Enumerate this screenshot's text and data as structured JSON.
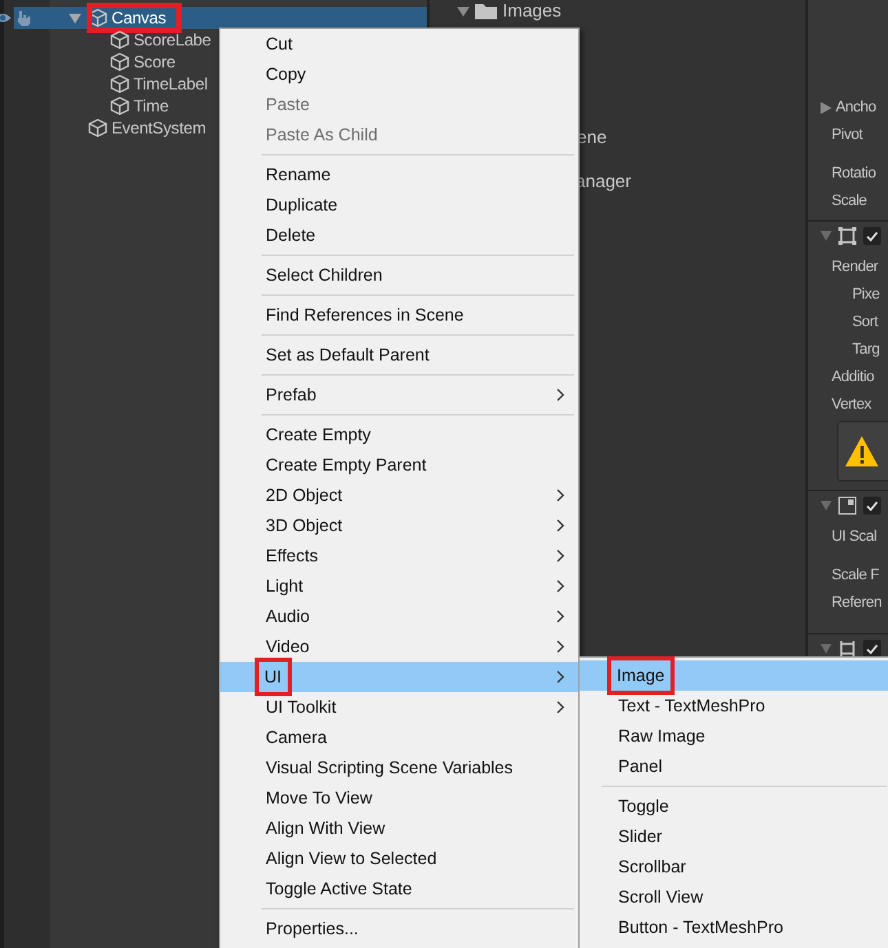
{
  "hierarchy": {
    "rows": [
      {
        "label": "Canvas",
        "selected": true,
        "expanded": true,
        "annotated": true,
        "children": [
          {
            "label": "ScoreLabe"
          },
          {
            "label": "Score"
          },
          {
            "label": "TimeLabel"
          },
          {
            "label": "Time"
          }
        ]
      },
      {
        "label": "EventSystem"
      }
    ]
  },
  "project": {
    "items": [
      {
        "label": "Images",
        "kind": "folder",
        "expanded": true
      },
      {
        "label": "ene",
        "kind": "fragment"
      },
      {
        "label": "anager",
        "kind": "fragment"
      }
    ]
  },
  "inspector": {
    "rows": [
      {
        "kind": "foldout",
        "label": "Ancho"
      },
      {
        "kind": "field",
        "label": "Pivot"
      },
      {
        "kind": "gap"
      },
      {
        "kind": "field",
        "label": "Rotatio"
      },
      {
        "kind": "field",
        "label": "Scale"
      },
      {
        "kind": "header",
        "enabled": true
      },
      {
        "kind": "field",
        "label": "Render"
      },
      {
        "kind": "subfield",
        "label": "Pixe"
      },
      {
        "kind": "subfield",
        "label": "Sort"
      },
      {
        "kind": "subfield",
        "label": "Targ"
      },
      {
        "kind": "field",
        "label": "Additio"
      },
      {
        "kind": "field",
        "label": "Vertex"
      },
      {
        "kind": "warning"
      },
      {
        "kind": "header",
        "enabled": true
      },
      {
        "kind": "field",
        "label": "UI Scal"
      },
      {
        "kind": "gap"
      },
      {
        "kind": "field",
        "label": "Scale F"
      },
      {
        "kind": "field",
        "label": "Referen"
      },
      {
        "kind": "gap"
      },
      {
        "kind": "header",
        "enabled": true
      }
    ]
  },
  "context_menu": {
    "items": [
      {
        "kind": "item",
        "label": "Cut",
        "disabled": false
      },
      {
        "kind": "item",
        "label": "Copy",
        "disabled": false
      },
      {
        "kind": "item",
        "label": "Paste",
        "disabled": true
      },
      {
        "kind": "item",
        "label": "Paste As Child",
        "disabled": true
      },
      {
        "kind": "separator"
      },
      {
        "kind": "item",
        "label": "Rename",
        "disabled": false
      },
      {
        "kind": "item",
        "label": "Duplicate",
        "disabled": false
      },
      {
        "kind": "item",
        "label": "Delete",
        "disabled": false
      },
      {
        "kind": "separator"
      },
      {
        "kind": "item",
        "label": "Select Children",
        "disabled": false
      },
      {
        "kind": "separator"
      },
      {
        "kind": "item",
        "label": "Find References in Scene",
        "disabled": false
      },
      {
        "kind": "separator"
      },
      {
        "kind": "item",
        "label": "Set as Default Parent",
        "disabled": false
      },
      {
        "kind": "separator"
      },
      {
        "kind": "item",
        "label": "Prefab",
        "disabled": false,
        "submenu": true
      },
      {
        "kind": "separator"
      },
      {
        "kind": "item",
        "label": "Create Empty",
        "disabled": false
      },
      {
        "kind": "item",
        "label": "Create Empty Parent",
        "disabled": false
      },
      {
        "kind": "item",
        "label": "2D Object",
        "disabled": false,
        "submenu": true
      },
      {
        "kind": "item",
        "label": "3D Object",
        "disabled": false,
        "submenu": true
      },
      {
        "kind": "item",
        "label": "Effects",
        "disabled": false,
        "submenu": true
      },
      {
        "kind": "item",
        "label": "Light",
        "disabled": false,
        "submenu": true
      },
      {
        "kind": "item",
        "label": "Audio",
        "disabled": false,
        "submenu": true
      },
      {
        "kind": "item",
        "label": "Video",
        "disabled": false,
        "submenu": true
      },
      {
        "kind": "item",
        "label": "UI",
        "disabled": false,
        "submenu": true,
        "selected": true,
        "annotated": true
      },
      {
        "kind": "item",
        "label": "UI Toolkit",
        "disabled": false,
        "submenu": true
      },
      {
        "kind": "item",
        "label": "Camera",
        "disabled": false
      },
      {
        "kind": "item",
        "label": "Visual Scripting Scene Variables",
        "disabled": false
      },
      {
        "kind": "item",
        "label": "Move To View",
        "disabled": false
      },
      {
        "kind": "item",
        "label": "Align With View",
        "disabled": false
      },
      {
        "kind": "item",
        "label": "Align View to Selected",
        "disabled": false
      },
      {
        "kind": "item",
        "label": "Toggle Active State",
        "disabled": false
      },
      {
        "kind": "separator"
      },
      {
        "kind": "item",
        "label": "Properties...",
        "disabled": false
      }
    ]
  },
  "submenu": {
    "items": [
      {
        "kind": "item",
        "label": "Image",
        "selected": true,
        "annotated": true
      },
      {
        "kind": "item",
        "label": "Text - TextMeshPro",
        "selected": false
      },
      {
        "kind": "item",
        "label": "Raw Image",
        "selected": false
      },
      {
        "kind": "item",
        "label": "Panel",
        "selected": false
      },
      {
        "kind": "separator"
      },
      {
        "kind": "item",
        "label": "Toggle",
        "selected": false
      },
      {
        "kind": "item",
        "label": "Slider",
        "selected": false
      },
      {
        "kind": "item",
        "label": "Scrollbar",
        "selected": false
      },
      {
        "kind": "item",
        "label": "Scroll View",
        "selected": false
      },
      {
        "kind": "item",
        "label": "Button - TextMeshPro",
        "selected": false
      }
    ]
  }
}
